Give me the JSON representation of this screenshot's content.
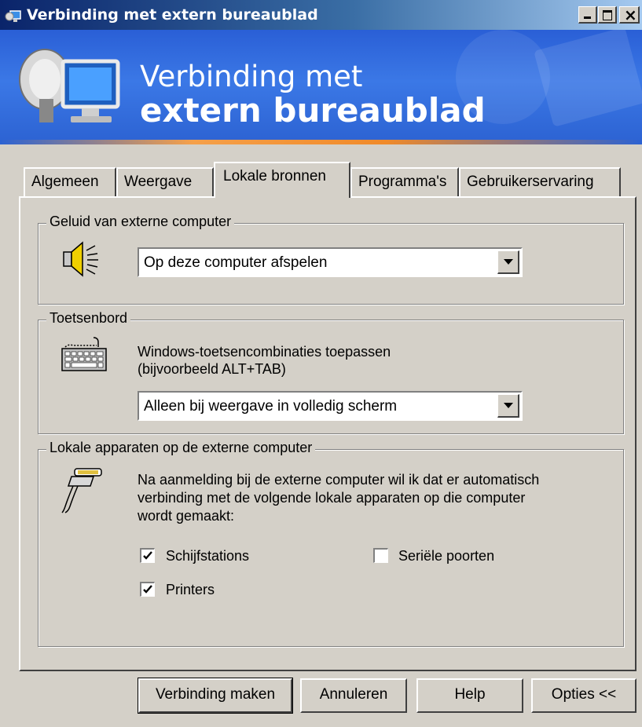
{
  "window": {
    "title": "Verbinding met extern bureaublad"
  },
  "banner": {
    "line1": "Verbinding met",
    "line2": "extern bureaublad"
  },
  "tabs": [
    {
      "label": "Algemeen"
    },
    {
      "label": "Weergave"
    },
    {
      "label": "Lokale bronnen",
      "active": true
    },
    {
      "label": "Programma's"
    },
    {
      "label": "Gebruikerservaring"
    }
  ],
  "sound_group": {
    "label": "Geluid van externe computer",
    "icon": "speaker-icon",
    "selected": "Op deze computer afspelen"
  },
  "keyboard_group": {
    "label": "Toetsenbord",
    "icon": "keyboard-icon",
    "description_line1": "Windows-toetsencombinaties toepassen",
    "description_line2": "(bijvoorbeeld ALT+TAB)",
    "selected": "Alleen bij weergave in volledig scherm"
  },
  "devices_group": {
    "label": "Lokale apparaten op de externe computer",
    "icon": "cable-icon",
    "description_line1": "Na aanmelding bij de externe computer wil ik dat er automatisch",
    "description_line2": "verbinding met de volgende lokale apparaten op die computer",
    "description_line3": "wordt gemaakt:",
    "checkboxes": [
      {
        "label": "Schijfstations",
        "checked": true
      },
      {
        "label": "Printers",
        "checked": true
      },
      {
        "label": "Seriële poorten",
        "checked": false
      }
    ]
  },
  "buttons": {
    "connect": "Verbinding maken",
    "cancel": "Annuleren",
    "help": "Help",
    "options": "Opties <<"
  }
}
